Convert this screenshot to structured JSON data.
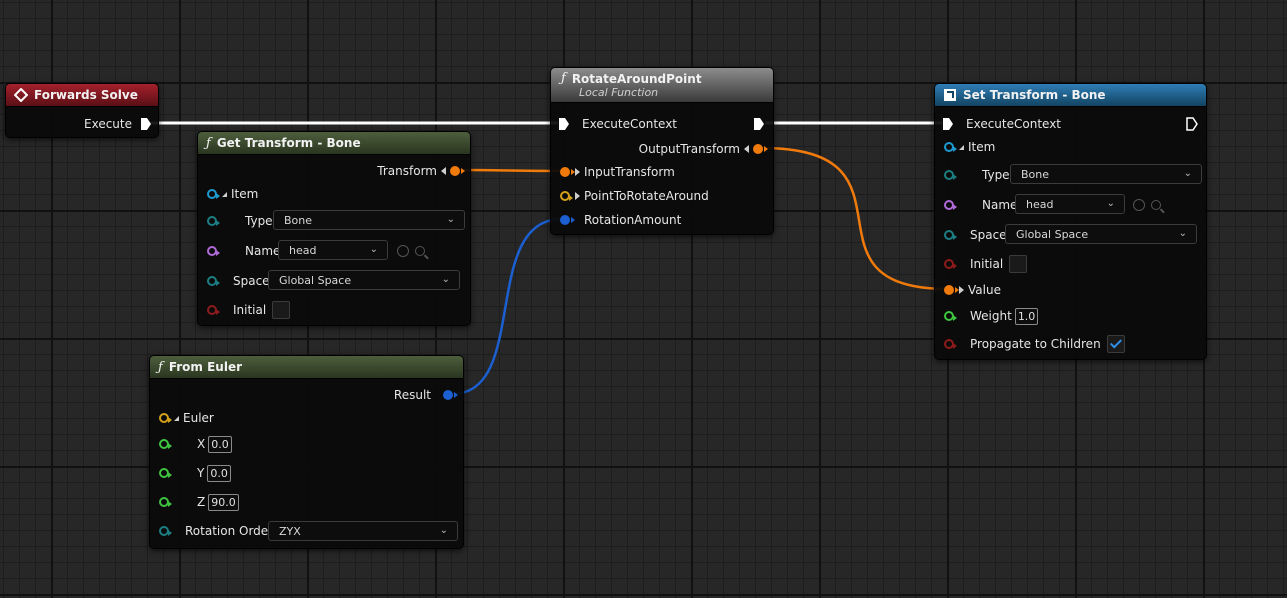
{
  "forwards_solve": {
    "title": "Forwards Solve",
    "execute": "Execute"
  },
  "get_transform": {
    "title": "Get Transform - Bone",
    "output": "Transform",
    "item": "Item",
    "type_label": "Type",
    "type_value": "Bone",
    "name_label": "Name",
    "name_value": "head",
    "space_label": "Space",
    "space_value": "Global Space",
    "initial_label": "Initial"
  },
  "from_euler": {
    "title": "From Euler",
    "result": "Result",
    "euler": "Euler",
    "x_label": "X",
    "x_value": "0.0",
    "y_label": "Y",
    "y_value": "0.0",
    "z_label": "Z",
    "z_value": "90.0",
    "order_label": "Rotation Order",
    "order_value": "ZYX"
  },
  "rotate": {
    "title": "RotateAroundPoint",
    "subtitle": "Local Function",
    "exec": "ExecuteContext",
    "output": "OutputTransform",
    "input_transform": "InputTransform",
    "point": "PointToRotateAround",
    "rotation": "RotationAmount"
  },
  "set_transform": {
    "title": "Set Transform - Bone",
    "exec": "ExecuteContext",
    "item": "Item",
    "type_label": "Type",
    "type_value": "Bone",
    "name_label": "Name",
    "name_value": "head",
    "space_label": "Space",
    "space_value": "Global Space",
    "initial_label": "Initial",
    "value_label": "Value",
    "weight_label": "Weight",
    "weight_value": "1.0",
    "propagate_label": "Propagate to Children",
    "propagate_checked": true
  },
  "colors": {
    "exec_wire": "#ffffff",
    "transform_wire": "#f07b0c",
    "rotation_wire": "#1b5fd0"
  },
  "icons": [
    "diamond-icon",
    "function-icon",
    "set-bone-icon",
    "exec-pin-icon",
    "chevron-down-icon",
    "reset-icon",
    "search-icon",
    "checkmark-icon"
  ]
}
